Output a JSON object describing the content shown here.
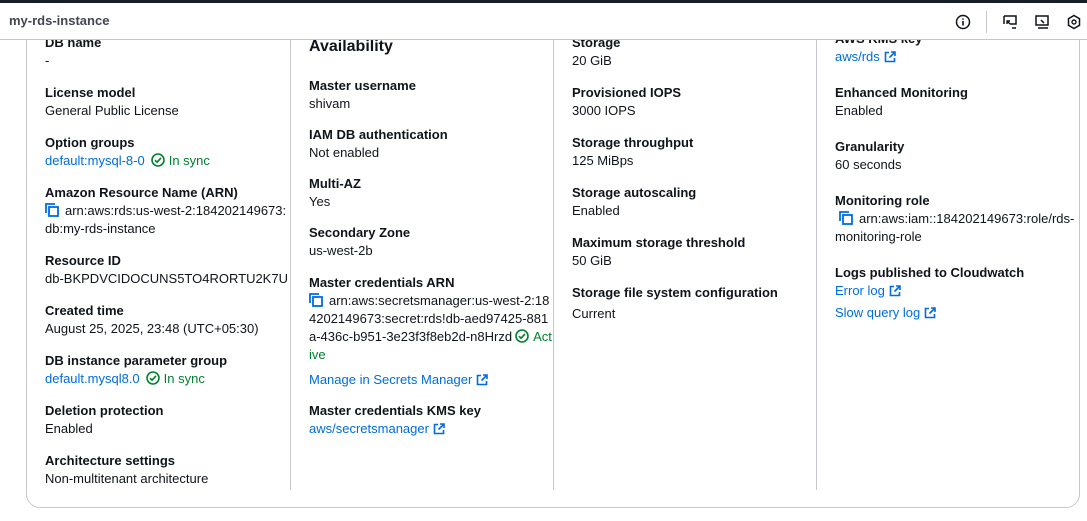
{
  "header": {
    "title": "my-rds-instance",
    "icons": [
      "info-icon",
      "feedback-icon",
      "screen-icon",
      "settings-icon"
    ]
  },
  "colors": {
    "link": "#006ce0",
    "success": "#00802f"
  },
  "col1": [
    {
      "label": "DB name",
      "value": "-"
    },
    {
      "label": "License model",
      "value": "General Public License"
    },
    {
      "label": "Option groups",
      "value": "default:mysql-8-0",
      "status": "In sync"
    },
    {
      "label": "Amazon Resource Name (ARN)",
      "value": "arn:aws:rds:us-west-2:184202149673:db:my-rds-instance"
    },
    {
      "label": "Resource ID",
      "value": "db-BKPDVCIDOCUNS5TO4RORTU2K7U"
    },
    {
      "label": "Created time",
      "value": "August 25, 2025, 23:48 (UTC+05:30)"
    },
    {
      "label": "DB instance parameter group",
      "value": "default.mysql8.0",
      "status": "In sync"
    },
    {
      "label": "Deletion protection",
      "value": "Enabled"
    },
    {
      "label": "Architecture settings",
      "value": "Non-multitenant architecture"
    }
  ],
  "col2": {
    "heading": "Availability",
    "fields": [
      {
        "label": "Master username",
        "value": "shivam"
      },
      {
        "label": "IAM DB authentication",
        "value": "Not enabled"
      },
      {
        "label": "Multi-AZ",
        "value": "Yes"
      },
      {
        "label": "Secondary Zone",
        "value": "us-west-2b"
      },
      {
        "label": "Master credentials ARN",
        "value": "arn:aws:secretsmanager:us-west-2:184202149673:secret:rds!db-aed97425-881a-436c-b951-3e23f3f8eb2d-n8Hrzd",
        "status": "Active",
        "link": "Manage in Secrets Manager"
      },
      {
        "label": "Master credentials KMS key",
        "value": "aws/secretsmanager"
      }
    ]
  },
  "col3": [
    {
      "label": "Storage",
      "value": "20 GiB"
    },
    {
      "label": "Provisioned IOPS",
      "value": "3000 IOPS"
    },
    {
      "label": "Storage throughput",
      "value": "125 MiBps"
    },
    {
      "label": "Storage autoscaling",
      "value": "Enabled"
    },
    {
      "label": "Maximum storage threshold",
      "value": "50 GiB"
    },
    {
      "label": "Storage file system configuration",
      "value": "Current"
    }
  ],
  "col4": [
    {
      "label": "AWS KMS key",
      "value": "aws/rds"
    },
    {
      "label": "Enhanced Monitoring",
      "value": "Enabled"
    },
    {
      "label": "Granularity",
      "value": "60 seconds"
    },
    {
      "label": "Monitoring role",
      "value": "arn:aws:iam::184202149673:role/rds-monitoring-role"
    },
    {
      "label": "Logs published to Cloudwatch",
      "links": [
        "Error log",
        "Slow query log"
      ]
    }
  ]
}
